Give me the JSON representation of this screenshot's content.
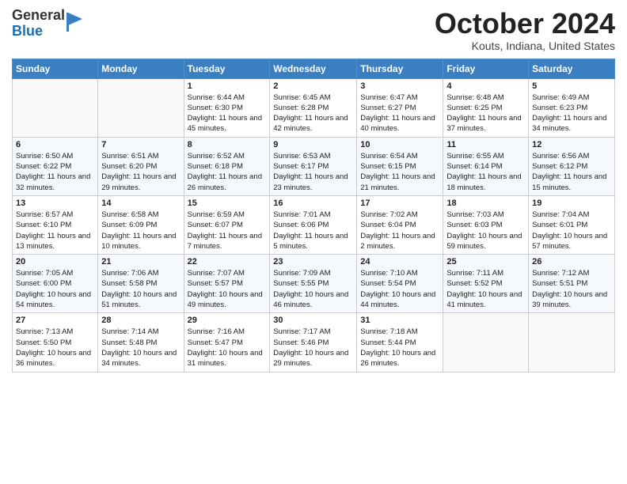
{
  "logo": {
    "general": "General",
    "blue": "Blue"
  },
  "title": "October 2024",
  "location": "Kouts, Indiana, United States",
  "days_of_week": [
    "Sunday",
    "Monday",
    "Tuesday",
    "Wednesday",
    "Thursday",
    "Friday",
    "Saturday"
  ],
  "weeks": [
    [
      {
        "day": "",
        "sunrise": "",
        "sunset": "",
        "daylight": ""
      },
      {
        "day": "",
        "sunrise": "",
        "sunset": "",
        "daylight": ""
      },
      {
        "day": "1",
        "sunrise": "Sunrise: 6:44 AM",
        "sunset": "Sunset: 6:30 PM",
        "daylight": "Daylight: 11 hours and 45 minutes."
      },
      {
        "day": "2",
        "sunrise": "Sunrise: 6:45 AM",
        "sunset": "Sunset: 6:28 PM",
        "daylight": "Daylight: 11 hours and 42 minutes."
      },
      {
        "day": "3",
        "sunrise": "Sunrise: 6:47 AM",
        "sunset": "Sunset: 6:27 PM",
        "daylight": "Daylight: 11 hours and 40 minutes."
      },
      {
        "day": "4",
        "sunrise": "Sunrise: 6:48 AM",
        "sunset": "Sunset: 6:25 PM",
        "daylight": "Daylight: 11 hours and 37 minutes."
      },
      {
        "day": "5",
        "sunrise": "Sunrise: 6:49 AM",
        "sunset": "Sunset: 6:23 PM",
        "daylight": "Daylight: 11 hours and 34 minutes."
      }
    ],
    [
      {
        "day": "6",
        "sunrise": "Sunrise: 6:50 AM",
        "sunset": "Sunset: 6:22 PM",
        "daylight": "Daylight: 11 hours and 32 minutes."
      },
      {
        "day": "7",
        "sunrise": "Sunrise: 6:51 AM",
        "sunset": "Sunset: 6:20 PM",
        "daylight": "Daylight: 11 hours and 29 minutes."
      },
      {
        "day": "8",
        "sunrise": "Sunrise: 6:52 AM",
        "sunset": "Sunset: 6:18 PM",
        "daylight": "Daylight: 11 hours and 26 minutes."
      },
      {
        "day": "9",
        "sunrise": "Sunrise: 6:53 AM",
        "sunset": "Sunset: 6:17 PM",
        "daylight": "Daylight: 11 hours and 23 minutes."
      },
      {
        "day": "10",
        "sunrise": "Sunrise: 6:54 AM",
        "sunset": "Sunset: 6:15 PM",
        "daylight": "Daylight: 11 hours and 21 minutes."
      },
      {
        "day": "11",
        "sunrise": "Sunrise: 6:55 AM",
        "sunset": "Sunset: 6:14 PM",
        "daylight": "Daylight: 11 hours and 18 minutes."
      },
      {
        "day": "12",
        "sunrise": "Sunrise: 6:56 AM",
        "sunset": "Sunset: 6:12 PM",
        "daylight": "Daylight: 11 hours and 15 minutes."
      }
    ],
    [
      {
        "day": "13",
        "sunrise": "Sunrise: 6:57 AM",
        "sunset": "Sunset: 6:10 PM",
        "daylight": "Daylight: 11 hours and 13 minutes."
      },
      {
        "day": "14",
        "sunrise": "Sunrise: 6:58 AM",
        "sunset": "Sunset: 6:09 PM",
        "daylight": "Daylight: 11 hours and 10 minutes."
      },
      {
        "day": "15",
        "sunrise": "Sunrise: 6:59 AM",
        "sunset": "Sunset: 6:07 PM",
        "daylight": "Daylight: 11 hours and 7 minutes."
      },
      {
        "day": "16",
        "sunrise": "Sunrise: 7:01 AM",
        "sunset": "Sunset: 6:06 PM",
        "daylight": "Daylight: 11 hours and 5 minutes."
      },
      {
        "day": "17",
        "sunrise": "Sunrise: 7:02 AM",
        "sunset": "Sunset: 6:04 PM",
        "daylight": "Daylight: 11 hours and 2 minutes."
      },
      {
        "day": "18",
        "sunrise": "Sunrise: 7:03 AM",
        "sunset": "Sunset: 6:03 PM",
        "daylight": "Daylight: 10 hours and 59 minutes."
      },
      {
        "day": "19",
        "sunrise": "Sunrise: 7:04 AM",
        "sunset": "Sunset: 6:01 PM",
        "daylight": "Daylight: 10 hours and 57 minutes."
      }
    ],
    [
      {
        "day": "20",
        "sunrise": "Sunrise: 7:05 AM",
        "sunset": "Sunset: 6:00 PM",
        "daylight": "Daylight: 10 hours and 54 minutes."
      },
      {
        "day": "21",
        "sunrise": "Sunrise: 7:06 AM",
        "sunset": "Sunset: 5:58 PM",
        "daylight": "Daylight: 10 hours and 51 minutes."
      },
      {
        "day": "22",
        "sunrise": "Sunrise: 7:07 AM",
        "sunset": "Sunset: 5:57 PM",
        "daylight": "Daylight: 10 hours and 49 minutes."
      },
      {
        "day": "23",
        "sunrise": "Sunrise: 7:09 AM",
        "sunset": "Sunset: 5:55 PM",
        "daylight": "Daylight: 10 hours and 46 minutes."
      },
      {
        "day": "24",
        "sunrise": "Sunrise: 7:10 AM",
        "sunset": "Sunset: 5:54 PM",
        "daylight": "Daylight: 10 hours and 44 minutes."
      },
      {
        "day": "25",
        "sunrise": "Sunrise: 7:11 AM",
        "sunset": "Sunset: 5:52 PM",
        "daylight": "Daylight: 10 hours and 41 minutes."
      },
      {
        "day": "26",
        "sunrise": "Sunrise: 7:12 AM",
        "sunset": "Sunset: 5:51 PM",
        "daylight": "Daylight: 10 hours and 39 minutes."
      }
    ],
    [
      {
        "day": "27",
        "sunrise": "Sunrise: 7:13 AM",
        "sunset": "Sunset: 5:50 PM",
        "daylight": "Daylight: 10 hours and 36 minutes."
      },
      {
        "day": "28",
        "sunrise": "Sunrise: 7:14 AM",
        "sunset": "Sunset: 5:48 PM",
        "daylight": "Daylight: 10 hours and 34 minutes."
      },
      {
        "day": "29",
        "sunrise": "Sunrise: 7:16 AM",
        "sunset": "Sunset: 5:47 PM",
        "daylight": "Daylight: 10 hours and 31 minutes."
      },
      {
        "day": "30",
        "sunrise": "Sunrise: 7:17 AM",
        "sunset": "Sunset: 5:46 PM",
        "daylight": "Daylight: 10 hours and 29 minutes."
      },
      {
        "day": "31",
        "sunrise": "Sunrise: 7:18 AM",
        "sunset": "Sunset: 5:44 PM",
        "daylight": "Daylight: 10 hours and 26 minutes."
      },
      {
        "day": "",
        "sunrise": "",
        "sunset": "",
        "daylight": ""
      },
      {
        "day": "",
        "sunrise": "",
        "sunset": "",
        "daylight": ""
      }
    ]
  ]
}
